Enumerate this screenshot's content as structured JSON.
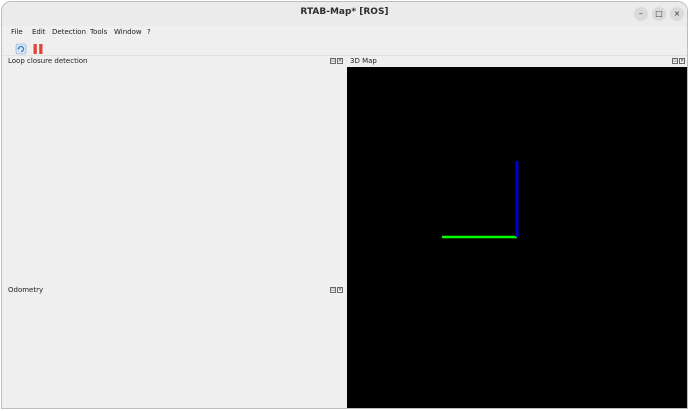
{
  "window": {
    "title": "RTAB-Map* [ROS]",
    "controls": {
      "minimize": "–",
      "maximize": "□",
      "close": "×"
    }
  },
  "menu": {
    "items": [
      "File",
      "Edit",
      "Detection",
      "Tools",
      "Window",
      "?"
    ]
  },
  "toolbar": {
    "buttons": [
      {
        "icon": "refresh-icon"
      },
      {
        "icon": "pause-icon"
      }
    ]
  },
  "panels": {
    "loop_closure": {
      "title": "Loop closure detection"
    },
    "odometry": {
      "title": "Odometry"
    },
    "map3d": {
      "title": "3D Map"
    }
  },
  "colors": {
    "map_background": "#000000",
    "axis_x": "#00ff00",
    "axis_z": "#0000cc",
    "pause_icon": "#e0443a",
    "refresh_icon": "#3a7fc8"
  }
}
